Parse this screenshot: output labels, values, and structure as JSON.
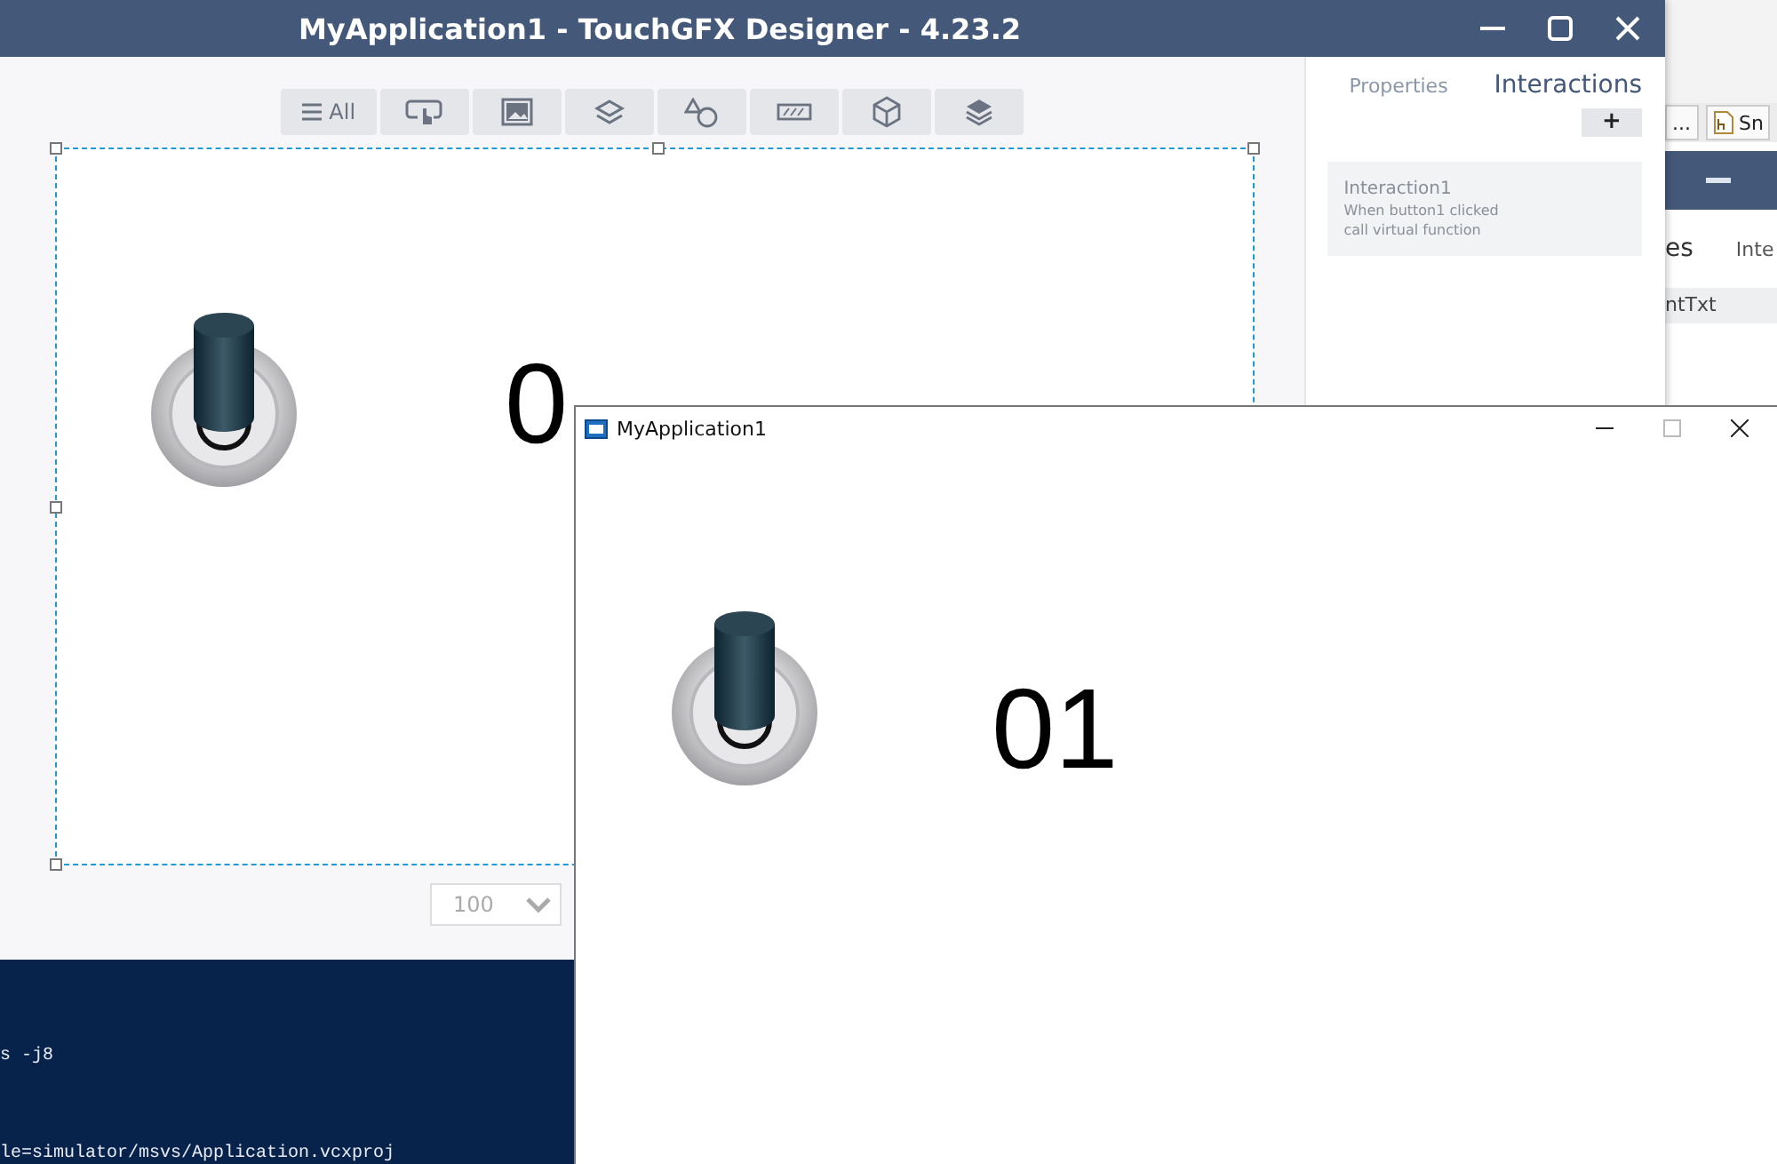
{
  "background_window": {
    "tabs": [
      {
        "label": "...",
        "kind": "plain"
      },
      {
        "label": "Sn",
        "kind": "file"
      }
    ],
    "tabs_below": [
      "es",
      "Inte"
    ],
    "row": "ntTxt"
  },
  "designer": {
    "title": "MyApplication1 - TouchGFX Designer - 4.23.2",
    "toolbar": [
      {
        "kind": "all",
        "label": "All"
      },
      {
        "kind": "touch"
      },
      {
        "kind": "image"
      },
      {
        "kind": "layers"
      },
      {
        "kind": "shapes"
      },
      {
        "kind": "progress"
      },
      {
        "kind": "box"
      },
      {
        "kind": "stack"
      }
    ],
    "canvas": {
      "counter": "0"
    },
    "zoom": {
      "value": "100"
    },
    "panel": {
      "tabs": [
        {
          "label": "Properties",
          "selected": false
        },
        {
          "label": "Interactions",
          "selected": true
        }
      ],
      "add_button": "+",
      "interactions": [
        {
          "name": "Interaction1",
          "trigger": "When button1 clicked",
          "action": "call virtual function"
        }
      ]
    }
  },
  "terminal": {
    "lines": [
      "s -j8",
      "le=simulator/msvs/Application.vcxproj"
    ]
  },
  "simulator": {
    "title": "MyApplication1",
    "counter": "01"
  }
}
